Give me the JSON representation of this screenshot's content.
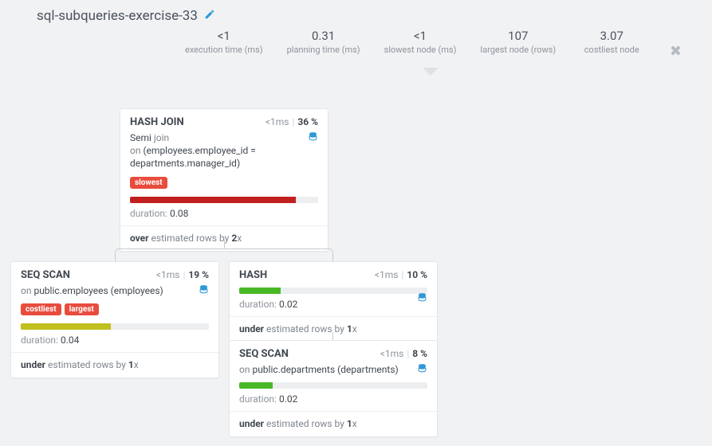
{
  "header": {
    "title": "sql-subqueries-exercise-33"
  },
  "stats": {
    "exec": {
      "value": "<1",
      "label": "execution time (ms)"
    },
    "plan": {
      "value": "0.31",
      "label": "planning time (ms)"
    },
    "slowest": {
      "value": "<1",
      "label": "slowest node (ms)"
    },
    "largest": {
      "value": "107",
      "label": "largest node (rows)"
    },
    "cost": {
      "value": "3.07",
      "label": "costliest node"
    }
  },
  "nodes": {
    "hashjoin": {
      "title": "HASH JOIN",
      "time": "<1",
      "time_suffix": "ms",
      "pct": "36 %",
      "sub_pre": "Semi ",
      "sub_join": "join",
      "sub_on_label": "on ",
      "sub_on": "(employees.employee_id = departments.manager_id)",
      "tag1": "slowest",
      "bar_color": "#c21f1f",
      "bar_pct": 88,
      "dur_label": "duration: ",
      "dur_value": "0.08",
      "est_pre": "over",
      "est_mid": " estimated rows by ",
      "est_x": "2",
      "est_xs": "x"
    },
    "seqscan_emp": {
      "title": "SEQ SCAN",
      "time": "<1",
      "time_suffix": "ms",
      "pct": "19 %",
      "sub_on_label": "on ",
      "sub_on": "public.employees (employees)",
      "tag1": "costliest",
      "tag2": "largest",
      "bar_color": "#c0bf1d",
      "bar_pct": 48,
      "dur_label": "duration: ",
      "dur_value": "0.04",
      "est_pre": "under",
      "est_mid": " estimated rows by ",
      "est_x": "1",
      "est_xs": "x"
    },
    "hash": {
      "title": "HASH",
      "time": "<1",
      "time_suffix": "ms",
      "pct": "10 %",
      "bar_color": "#49b827",
      "bar_pct": 22,
      "dur_label": "duration: ",
      "dur_value": "0.02",
      "est_pre": "under",
      "est_mid": " estimated rows by ",
      "est_x": "1",
      "est_xs": "x"
    },
    "seqscan_dept": {
      "title": "SEQ SCAN",
      "time": "<1",
      "time_suffix": "ms",
      "pct": "8 %",
      "sub_on_label": "on ",
      "sub_on": "public.departments (departments)",
      "bar_color": "#49b827",
      "bar_pct": 18,
      "dur_label": "duration: ",
      "dur_value": "0.02",
      "est_pre": "under",
      "est_mid": " estimated rows by ",
      "est_x": "1",
      "est_xs": "x"
    }
  }
}
